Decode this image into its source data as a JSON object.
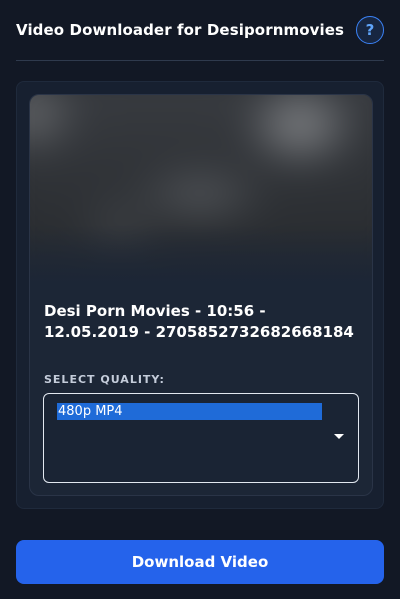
{
  "header": {
    "title": "Video Downloader for Desipornmovies",
    "help_label": "?"
  },
  "video": {
    "thumbnail": "blurred-video-preview",
    "title": "Desi Porn Movies - 10:56 - 12.05.2019 - 2705852732682668184"
  },
  "quality": {
    "label": "SELECT QUALITY:",
    "selected": "480p MP4"
  },
  "actions": {
    "download_label": "Download Video"
  },
  "colors": {
    "background": "#121825",
    "card": "#1c2636",
    "accent": "#2563eb",
    "selection": "#1f6bd8"
  },
  "icons": {
    "help": "question-mark-icon",
    "dropdown": "chevron-down-icon"
  }
}
